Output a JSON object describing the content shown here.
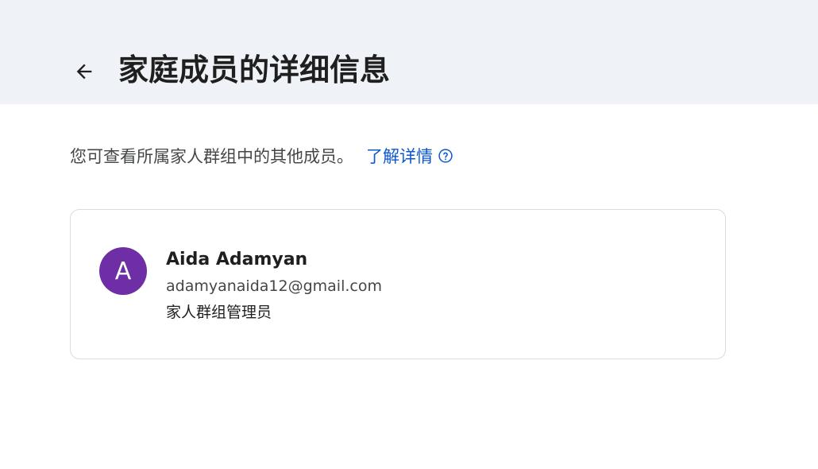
{
  "header": {
    "title": "家庭成员的详细信息",
    "back_icon": "arrow-back-icon"
  },
  "intro": {
    "text": "您可查看所属家人群组中的其他成员。",
    "learn_more": "了解详情",
    "help_icon": "help-circle-icon"
  },
  "member": {
    "avatar_letter": "A",
    "name": "Aida Adamyan",
    "email": "adamyanaida12@gmail.com",
    "role": "家人群组管理员"
  },
  "colors": {
    "header_bg": "#eff2f6",
    "link": "#0b57d0",
    "avatar_bg": "#6e2ea5"
  }
}
